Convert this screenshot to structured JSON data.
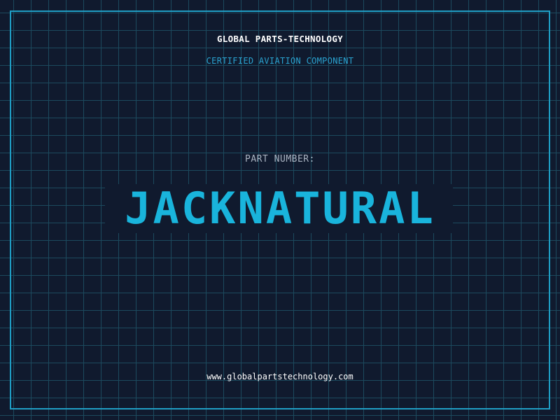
{
  "card": {
    "brand": "GLOBAL PARTS-TECHNOLOGY",
    "subtitle": "CERTIFIED AVIATION COMPONENT",
    "part_label": "PART NUMBER:",
    "part_number": "JACKNATURAL",
    "website": "www.globalpartstechnology.com"
  },
  "colors": {
    "background": "#101a2e",
    "grid": "#1c4a5e",
    "accent": "#19b4dc",
    "frame": "#1f9dc4"
  }
}
